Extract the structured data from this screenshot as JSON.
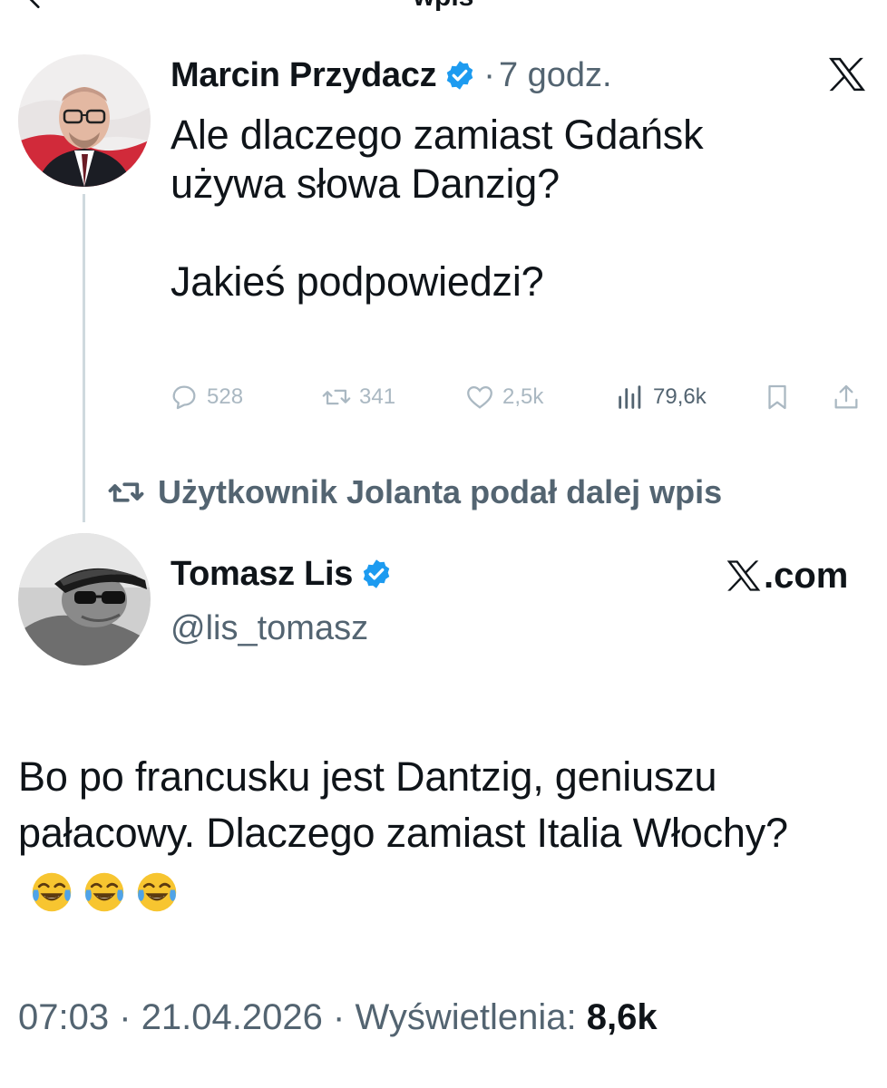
{
  "header": {
    "title": "wpis"
  },
  "tweet1": {
    "author": "Marcin Przydacz",
    "separator": "·",
    "time": "7 godz.",
    "text": "Ale dlaczego zamiast Gdańsk\nużywa słowa Danzig?\n\nJakieś podpowiedzi?",
    "stats": {
      "replies": "528",
      "reposts": "341",
      "likes": "2,5k",
      "views": "79,6k"
    }
  },
  "repost": {
    "label": "Użytkownik Jolanta podał dalej wpis"
  },
  "tweet2": {
    "author": "Tomasz Lis",
    "handle": "@lis_tomasz",
    "source": ".com",
    "text": "Bo po francusku jest Dantzig, geniuszu pałacowy. Dlaczego zamiast Italia Włochy?",
    "meta_time": "07:03",
    "meta_sep1": "·",
    "meta_date": "21.04.2026",
    "meta_sep2": "·",
    "meta_views_label": "Wyświetlenia:",
    "meta_views": "8,6k"
  },
  "colors": {
    "accent": "#1d9bf0",
    "muted": "#536471",
    "text": "#0f1419"
  },
  "icons": [
    "back-arrow-icon",
    "verified-badge-icon",
    "x-logo-icon",
    "reply-icon",
    "retweet-icon",
    "like-icon",
    "views-icon",
    "bookmark-icon",
    "share-icon",
    "emoji-tears-of-joy-icon"
  ]
}
